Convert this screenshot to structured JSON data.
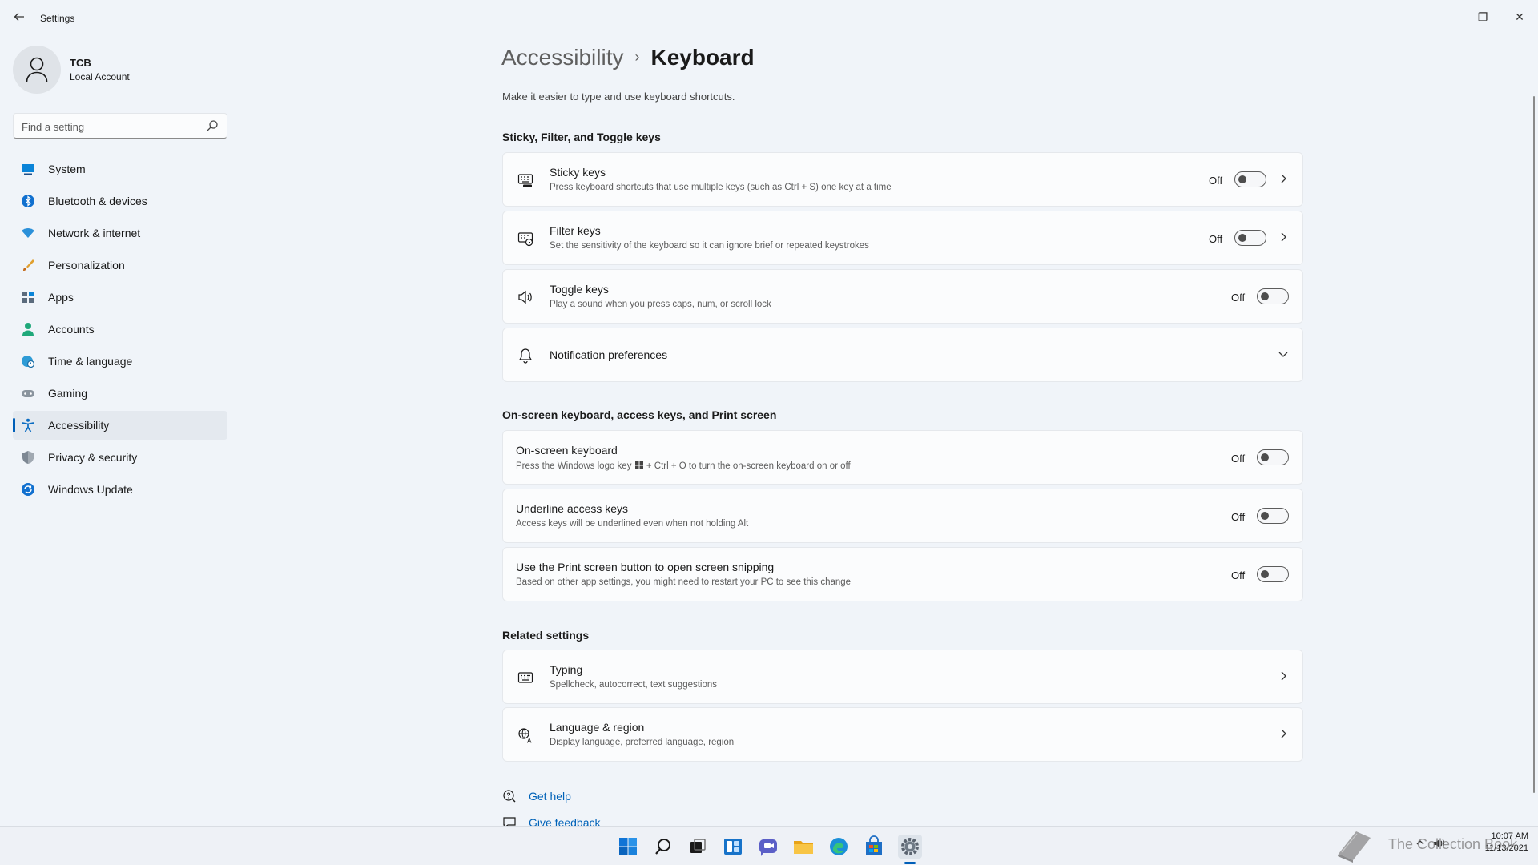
{
  "window": {
    "title": "Settings",
    "controls": {
      "minimize": "—",
      "maximize": "❐",
      "close": "✕"
    }
  },
  "profile": {
    "name": "TCB",
    "account_type": "Local Account"
  },
  "search": {
    "placeholder": "Find a setting"
  },
  "sidebar": {
    "items": [
      {
        "label": "System",
        "icon": "system-icon"
      },
      {
        "label": "Bluetooth & devices",
        "icon": "bluetooth-icon"
      },
      {
        "label": "Network & internet",
        "icon": "wifi-icon"
      },
      {
        "label": "Personalization",
        "icon": "brush-icon"
      },
      {
        "label": "Apps",
        "icon": "apps-icon"
      },
      {
        "label": "Accounts",
        "icon": "person-icon"
      },
      {
        "label": "Time & language",
        "icon": "globe-clock-icon"
      },
      {
        "label": "Gaming",
        "icon": "gamepad-icon"
      },
      {
        "label": "Accessibility",
        "icon": "accessibility-icon",
        "active": true
      },
      {
        "label": "Privacy & security",
        "icon": "shield-icon"
      },
      {
        "label": "Windows Update",
        "icon": "update-icon"
      }
    ]
  },
  "header": {
    "breadcrumb_parent": "Accessibility",
    "breadcrumb_sep": "›",
    "title": "Keyboard",
    "description": "Make it easier to type and use keyboard shortcuts."
  },
  "sections": {
    "sticky": {
      "title": "Sticky, Filter, and Toggle keys",
      "items": [
        {
          "title": "Sticky keys",
          "subtitle": "Press keyboard shortcuts that use multiple keys (such as Ctrl + S) one key at a time",
          "state": "Off"
        },
        {
          "title": "Filter keys",
          "subtitle": "Set the sensitivity of the keyboard so it can ignore brief or repeated keystrokes",
          "state": "Off"
        },
        {
          "title": "Toggle keys",
          "subtitle": "Play a sound when you press caps, num, or scroll lock",
          "state": "Off"
        },
        {
          "title": "Notification preferences"
        }
      ]
    },
    "onscreen": {
      "title": "On-screen keyboard, access keys, and Print screen",
      "items": [
        {
          "title": "On-screen keyboard",
          "subtitle_pre": "Press the Windows logo key",
          "subtitle_post": "+ Ctrl + O to turn the on-screen keyboard on or off",
          "state": "Off"
        },
        {
          "title": "Underline access keys",
          "subtitle": "Access keys will be underlined even when not holding Alt",
          "state": "Off"
        },
        {
          "title": "Use the Print screen button to open screen snipping",
          "subtitle": "Based on other app settings, you might need to restart your PC to see this change",
          "state": "Off"
        }
      ]
    },
    "related": {
      "title": "Related settings",
      "items": [
        {
          "title": "Typing",
          "subtitle": "Spellcheck, autocorrect, text suggestions"
        },
        {
          "title": "Language & region",
          "subtitle": "Display language, preferred language, region"
        }
      ]
    }
  },
  "footer_links": {
    "help": "Get help",
    "feedback": "Give feedback"
  },
  "taskbar": {
    "apps": [
      "start-icon",
      "search-icon",
      "task-view-icon",
      "widgets-icon",
      "chat-icon",
      "file-explorer-icon",
      "edge-icon",
      "store-icon",
      "settings-icon"
    ],
    "time": "10:07 AM",
    "date": "11/13/2021",
    "watermark": "The Collection Book"
  },
  "colors": {
    "accent": "#005fb8",
    "link": "#0062b8",
    "background": "#f0f4f9",
    "card": "#fbfcfd"
  }
}
